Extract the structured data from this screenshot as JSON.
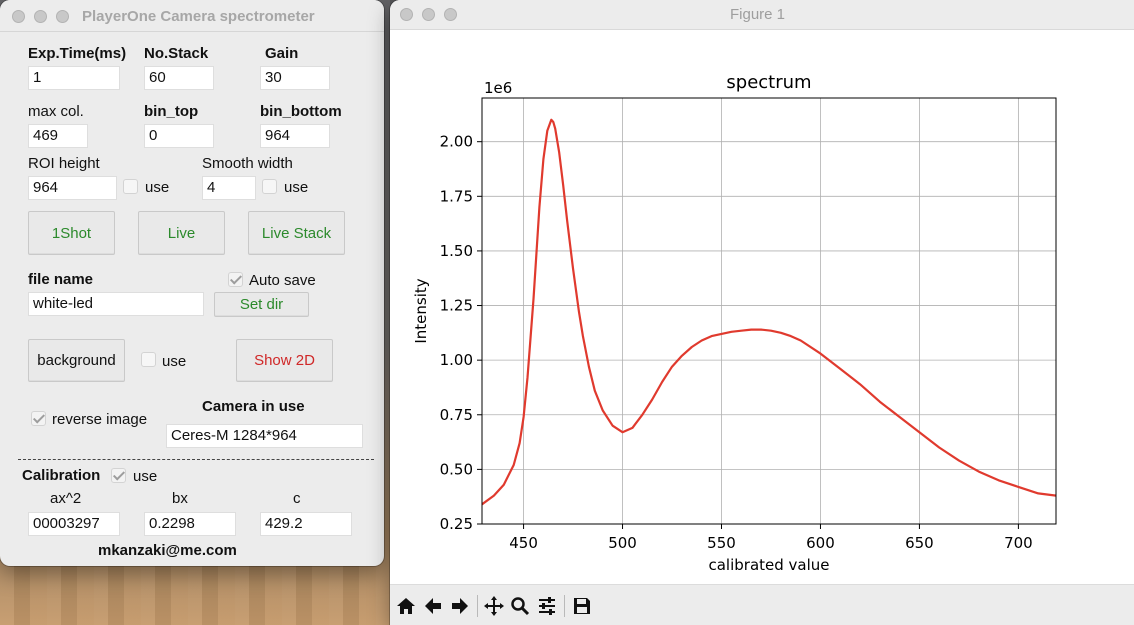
{
  "control_window": {
    "title": "PlayerOne Camera spectrometer",
    "exposure": {
      "label": "Exp.Time(ms)",
      "value": "1"
    },
    "stack": {
      "label": "No.Stack",
      "value": "60"
    },
    "gain": {
      "label": "Gain",
      "value": "30"
    },
    "max_col": {
      "label": "max col.",
      "value": "469"
    },
    "bin_top": {
      "label": "bin_top",
      "value": "0"
    },
    "bin_bottom": {
      "label": "bin_bottom",
      "value": "964"
    },
    "roi_height": {
      "label": "ROI height",
      "value": "964",
      "use_label": "use",
      "use_checked": false
    },
    "smooth_width": {
      "label": "Smooth width",
      "value": "4",
      "use_label": "use",
      "use_checked": false
    },
    "buttons": {
      "one_shot": "1Shot",
      "live": "Live",
      "live_stack": "Live Stack"
    },
    "file_name": {
      "label": "file name",
      "value": "white-led"
    },
    "auto_save": {
      "label": "Auto save",
      "checked": true
    },
    "set_dir": "Set dir",
    "background": {
      "button": "background",
      "use_label": "use",
      "use_checked": false
    },
    "show_2d": "Show 2D",
    "reverse_image": {
      "label": "reverse image",
      "checked": true
    },
    "camera": {
      "label": "Camera in use",
      "value": "Ceres-M 1284*964"
    },
    "calibration": {
      "label": "Calibration",
      "use_label": "use",
      "use_checked": true,
      "ax2": {
        "label": "ax^2",
        "value": "00003297"
      },
      "bx": {
        "label": "bx",
        "value": "0.2298"
      },
      "c": {
        "label": "c",
        "value": "429.2"
      }
    },
    "footer": "mkanzaki@me.com"
  },
  "figure_window": {
    "title": "Figure 1",
    "toolbar_icons": [
      "home-icon",
      "back-arrow-icon",
      "forward-arrow-icon",
      "pan-icon",
      "zoom-icon",
      "configure-subplots-icon",
      "save-icon"
    ]
  },
  "chart_data": {
    "type": "line",
    "title": "spectrum",
    "xlabel": "calibrated value",
    "ylabel": "Intensity",
    "y_offset_label": "1e6",
    "xlim": [
      429,
      719
    ],
    "ylim": [
      0.25,
      2.2
    ],
    "xticks": [
      450,
      500,
      550,
      600,
      650,
      700
    ],
    "yticks": [
      0.25,
      0.5,
      0.75,
      1.0,
      1.25,
      1.5,
      1.75,
      2.0
    ],
    "xtick_labels": [
      "450",
      "500",
      "550",
      "600",
      "650",
      "700"
    ],
    "ytick_labels": [
      "0.25",
      "0.50",
      "0.75",
      "1.00",
      "1.25",
      "1.50",
      "1.75",
      "2.00"
    ],
    "grid": true,
    "line_color": "#e03a2e",
    "series": [
      {
        "x": [
          429,
          435,
          440,
          445,
          448,
          450,
          452,
          455,
          458,
          460,
          462,
          464,
          465,
          466,
          468,
          470,
          472,
          475,
          478,
          480,
          483,
          486,
          490,
          495,
          500,
          505,
          510,
          515,
          520,
          525,
          530,
          535,
          540,
          545,
          550,
          555,
          560,
          565,
          570,
          575,
          580,
          585,
          590,
          600,
          610,
          620,
          630,
          640,
          650,
          660,
          670,
          680,
          690,
          700,
          710,
          719
        ],
        "y": [
          0.34,
          0.38,
          0.43,
          0.52,
          0.62,
          0.74,
          0.92,
          1.28,
          1.7,
          1.92,
          2.05,
          2.1,
          2.09,
          2.06,
          1.95,
          1.8,
          1.64,
          1.42,
          1.22,
          1.11,
          0.97,
          0.86,
          0.77,
          0.7,
          0.67,
          0.69,
          0.75,
          0.82,
          0.9,
          0.97,
          1.02,
          1.06,
          1.09,
          1.11,
          1.12,
          1.13,
          1.135,
          1.14,
          1.14,
          1.135,
          1.125,
          1.11,
          1.09,
          1.03,
          0.96,
          0.89,
          0.81,
          0.74,
          0.67,
          0.6,
          0.54,
          0.49,
          0.45,
          0.42,
          0.39,
          0.38
        ]
      }
    ]
  }
}
